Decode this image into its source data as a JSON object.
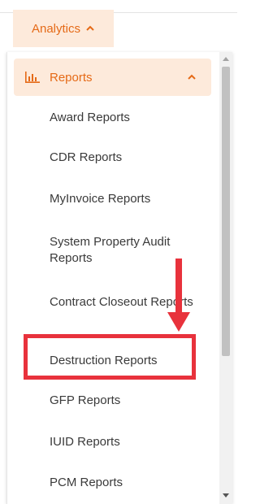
{
  "topbar": {
    "analytics_label": "Analytics",
    "analytics_icon": "chevron-up-icon"
  },
  "sidebar": {
    "section": {
      "label": "Reports",
      "icon": "bar-chart-icon",
      "toggle_icon": "chevron-up-icon"
    },
    "items": [
      {
        "label": "Award Reports"
      },
      {
        "label": "CDR Reports"
      },
      {
        "label": "MyInvoice Reports"
      },
      {
        "label": "System Property Audit Reports"
      },
      {
        "label": "Contract Closeout Reports"
      },
      {
        "label": "Destruction Reports"
      },
      {
        "label": "GFP Reports"
      },
      {
        "label": "IUID Reports"
      },
      {
        "label": "PCM Reports"
      }
    ]
  },
  "annotations": {
    "highlighted_item": "Destruction Reports",
    "highlight_color": "#e8323c",
    "arrow_color": "#e8323c"
  },
  "colors": {
    "accent": "#e56a17",
    "accent_bg": "#fdeadb",
    "text": "#3a3a3a"
  }
}
